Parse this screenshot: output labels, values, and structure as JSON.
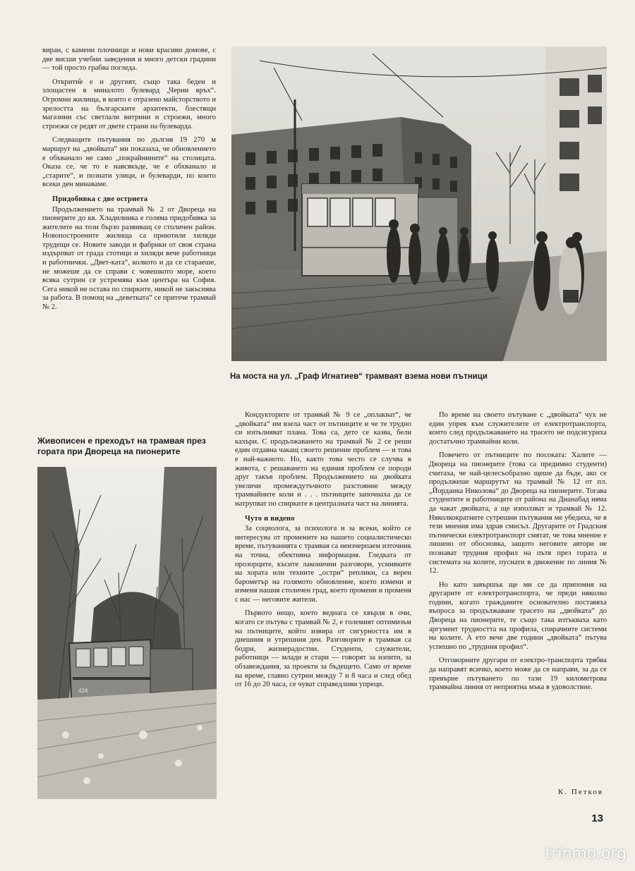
{
  "col1": {
    "p1": "виран, с камени плочници и нови красиви домове, с две висши учебни заведения и много детски градини — той просто грабва погледа.",
    "p2": "Открити̂е е и другият, също така беден и злощастен в миналото булевард „Черни връх“. Огромни жилища, в които е отразено майсторството и зрелостта на българските архитекти, блестящи магазини със светлали витрини и строежи, много строежи се редят от двете страни на булеварда.",
    "p3": "Следващите пътувания по дългия 19 270 м маршрут на „двойката“ ми показаха, че обновлението е обхванало не само „покрайнините“ на столицата. Оказа се, че то е навсякъде, че е обхванало и „старите“, и познати улици, и булеварди, по които всеки ден минаваме.",
    "heading": "Придобивка с две остриета",
    "p4": "Продължението на трамвай № 2 от Двореца на пионерите до кв. Хладилника е голяма придобивка за жителите на този бързо развиващ се столичен район. Новопостроените жилища са приютили хиляди трудещи се. Новите заводи и фабрики от своя страна издърпват от града стотици и хиляди вече работници и работнички. „Двет-ката“, колкото и да се стараеше, не можеше да се справи с човешкото море, което всяка сутрин се устремява към центъра на София. Сега никой не остава по спирките, никой не закъснява за работа. В помощ на „деветката“ се притече трамвай № 2."
  },
  "photo1": {
    "caption": "На моста на ул. „Граф Игнатиев“ трамваят взема нови пътници"
  },
  "photo2": {
    "caption": "Живописен е преходът на трамвая през гората при Двореца на пионерите",
    "tram_number": "424"
  },
  "col2": {
    "p1": "Кондукторите от трамвай № 9 се „оплакват“, че „двойката“ им взела част от пътниците и че те трудно си изпълняват плана. Това са, дето се казва, бели кахъри. С продължаването на трамвай № 2 се реши един отдавна чакащ своето решение проблем — и това е най-важното. Но, както това често се случва в живота, с решаването на единия проблем се породи друг такъв проблем. Продължението на двойката увеличи промеждутъчното разстояние между трамвайните коли и . . . пътниците започнаха да се натрупват по спирките в централната част на линията.",
    "heading": "Чуто и видено",
    "p2": "За социолога, за психолога и за всеки, който се интересува от промените на нашето социалистическо време, пътуванията с трамвая са неизчерпаем източник на точна, обективна информация. Гледката от прозорците, късите лаконични разговори, усмивките на хората или техните „остри“ реплики, са верен барометър на голямото обновление, което измени и изменя нашия столичен град, което промени и променя с нас — неговите жители.",
    "p3": "Първото нещо, което веднага се хвърля в очи, когато се пътува с трамвай № 2, е големият оптимизъм на пътниците, който извира от сигурността им в днешния и утрешния ден. Разговорите в трамвая са бодри, жизнерадостни. Студенти, служители, работници — млади и стари — говорят за изпити, за обзавеждания, за проекти за бъдещето. Само от време на време, главно сутрин между 7 и 8 часа и след обед от 16 до 20 часа, се чуват справедливи упреци."
  },
  "col3": {
    "p1": "По време на своето пътуване с „двойката“ чух не един упрек към служителите от електротранспорта, които след продължаването на трасето не подсигуриха достатъчно трамвайни коли.",
    "p2": "Повечето от пътниците по посоката: Халите — Двореца на пионерите (това са предимно студенти) считаха, че най-целесъобразно щеше да бъде, ако се продължеше маршрутът на трамвай № 12 от пл. „Йорданка Николова“ до Двореца на пионерите. Тогава студентите и работниците от района на Дианабад няма да чакат двойката, а ще използват и трамвай № 12. Няколкократните сутрешни пътувания ме убедиха, че в тези мнения има здрав смисъл. Другарите от Градския пътнически електротранспорт смятат, че това мнение е лишено от обосновка, защото неговите автори не познават трудния профил на пътя през гората и системата на колите, пуснати в движение по линия № 12.",
    "p3": "Но като завършък ще ми се да припомня на другарите от електротранспорта, че преди няколко години, когато гражданите основателно поставяха въпроса за продължаване трасето на „двойката“ до Двореца на пионерите, те също така изтъкваха като аргумент трудността на профила, спирачните системи на колите. А ето вече две години „двойката“ пътува успешно по „трудния профил“.",
    "p4": "Отговорните другари от електро-транспорта трябва да направят всичко, което може да се направи, за да се превърне пътуването по тази 19 километрова трамвайна линия от неприятна мъка в удоволствие."
  },
  "author": "К. Петков",
  "page_number": "13",
  "watermark": "trinmo.org"
}
